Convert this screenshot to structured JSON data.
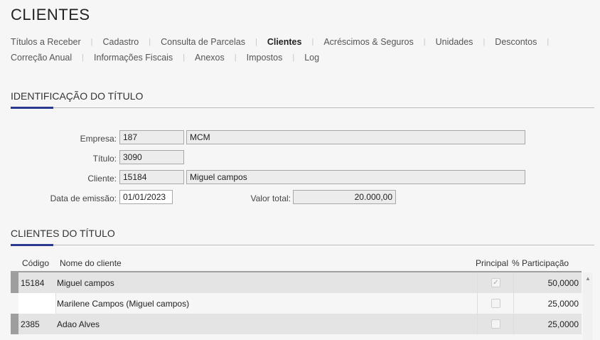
{
  "page": {
    "title": "CLIENTES"
  },
  "tabs": {
    "row1": [
      "Títulos a Receber",
      "Cadastro",
      "Consulta de Parcelas",
      "Clientes",
      "Acréscimos & Seguros",
      "Unidades",
      "Descontos"
    ],
    "row2": [
      "Correção Anual",
      "Informações Fiscais",
      "Anexos",
      "Impostos",
      "Log"
    ],
    "active": "Clientes",
    "separator": "|"
  },
  "identificacao": {
    "section_title": "IDENTIFICAÇÃO DO TÍTULO",
    "empresa_label": "Empresa:",
    "empresa_code": "187",
    "empresa_name": "MCM",
    "titulo_label": "Título:",
    "titulo_value": "3090",
    "cliente_label": "Cliente:",
    "cliente_code": "15184",
    "cliente_name": "Miguel campos",
    "data_label": "Data de emissão:",
    "data_value": "01/01/2023",
    "valor_label": "Valor total:",
    "valor_value": "20.000,00"
  },
  "clientes": {
    "section_title": "CLIENTES DO TÍTULO",
    "columns": {
      "codigo": "Código",
      "nome": "Nome do cliente",
      "principal": "Principal",
      "participacao": "% Participação"
    },
    "rows": [
      {
        "codigo": "15184",
        "nome": "Miguel campos",
        "principal": true,
        "participacao": "50,0000"
      },
      {
        "codigo": "",
        "nome": "Marilene Campos (Miguel campos)",
        "principal": false,
        "participacao": "25,0000"
      },
      {
        "codigo": "2385",
        "nome": "Adao Alves",
        "principal": false,
        "participacao": "25,0000"
      }
    ]
  },
  "icons": {
    "checkmark": "✓",
    "scroll_up": "▲"
  }
}
